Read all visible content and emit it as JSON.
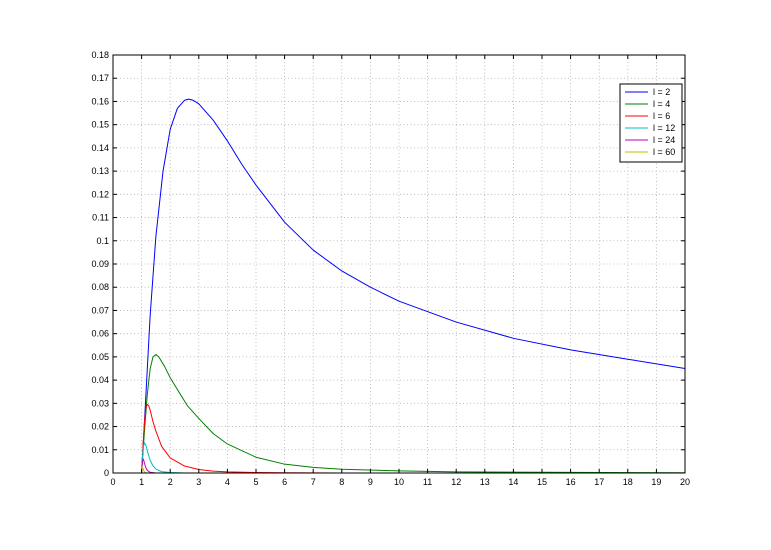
{
  "chart_data": {
    "type": "line",
    "title": "",
    "xlabel": "",
    "ylabel": "",
    "xlim": [
      0,
      20
    ],
    "ylim": [
      0,
      0.18
    ],
    "x_ticks": [
      0,
      1,
      2,
      3,
      4,
      5,
      6,
      7,
      8,
      9,
      10,
      11,
      12,
      13,
      14,
      15,
      16,
      17,
      18,
      19,
      20
    ],
    "y_ticks": [
      0,
      0.01,
      0.02,
      0.03,
      0.04,
      0.05,
      0.06,
      0.07,
      0.08,
      0.09,
      0.1,
      0.11,
      0.12,
      0.13,
      0.14,
      0.15,
      0.16,
      0.17,
      0.18
    ],
    "grid": true,
    "legend_position": "top-right",
    "series": [
      {
        "name": "l = 2",
        "color": "#0000ff",
        "x": [
          1,
          1.1,
          1.2,
          1.3,
          1.5,
          1.75,
          2,
          2.25,
          2.5,
          2.65,
          2.8,
          3,
          3.5,
          4,
          4.5,
          5,
          6,
          7,
          8,
          9,
          10,
          12,
          14,
          16,
          18,
          20
        ],
        "values": [
          0,
          0.022,
          0.045,
          0.068,
          0.102,
          0.13,
          0.148,
          0.157,
          0.1605,
          0.161,
          0.1605,
          0.159,
          0.152,
          0.143,
          0.133,
          0.124,
          0.108,
          0.096,
          0.087,
          0.08,
          0.074,
          0.065,
          0.058,
          0.053,
          0.049,
          0.045
        ]
      },
      {
        "name": "l = 4",
        "color": "#008000",
        "x": [
          1,
          1.1,
          1.2,
          1.3,
          1.4,
          1.5,
          1.6,
          1.8,
          2,
          2.3,
          2.6,
          3,
          3.5,
          4,
          5,
          6,
          7,
          8,
          10,
          12,
          15,
          20
        ],
        "values": [
          0,
          0.018,
          0.034,
          0.045,
          0.05,
          0.051,
          0.05,
          0.046,
          0.041,
          0.035,
          0.029,
          0.0235,
          0.017,
          0.0125,
          0.0068,
          0.0038,
          0.0024,
          0.0016,
          0.0009,
          0.0005,
          0.0003,
          0.0001
        ]
      },
      {
        "name": "l = 6",
        "color": "#ff0000",
        "x": [
          1,
          1.05,
          1.1,
          1.15,
          1.2,
          1.25,
          1.3,
          1.4,
          1.5,
          1.7,
          2,
          2.5,
          3,
          3.5,
          4,
          5,
          6,
          8,
          12,
          20
        ],
        "values": [
          0,
          0.012,
          0.022,
          0.028,
          0.0295,
          0.029,
          0.027,
          0.022,
          0.018,
          0.0115,
          0.0065,
          0.003,
          0.0015,
          0.0008,
          0.0005,
          0.0002,
          0.0001,
          0,
          0,
          0
        ]
      },
      {
        "name": "l = 12",
        "color": "#00bfbf",
        "x": [
          1,
          1.03,
          1.06,
          1.1,
          1.15,
          1.2,
          1.3,
          1.4,
          1.5,
          1.7,
          2,
          2.5,
          3,
          5,
          20
        ],
        "values": [
          0,
          0.007,
          0.011,
          0.013,
          0.012,
          0.0095,
          0.0055,
          0.003,
          0.0017,
          0.0006,
          0.0002,
          0,
          0,
          0,
          0
        ]
      },
      {
        "name": "l = 24",
        "color": "#bf00bf",
        "x": [
          1,
          1.02,
          1.04,
          1.06,
          1.08,
          1.1,
          1.15,
          1.2,
          1.3,
          1.5,
          2,
          20
        ],
        "values": [
          0,
          0.004,
          0.0058,
          0.006,
          0.0052,
          0.0042,
          0.0022,
          0.0011,
          0.0003,
          0,
          0,
          0
        ]
      },
      {
        "name": "l = 60",
        "color": "#bfbf00",
        "x": [
          1,
          1.01,
          1.02,
          1.03,
          1.05,
          1.08,
          1.12,
          1.2,
          2,
          20
        ],
        "values": [
          0,
          0.0015,
          0.0024,
          0.0026,
          0.0019,
          0.0009,
          0.0002,
          0,
          0,
          0
        ]
      }
    ]
  }
}
